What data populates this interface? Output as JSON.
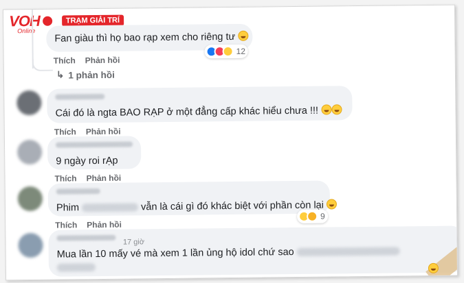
{
  "watermark": {
    "brand": "VOH",
    "sub": "Online",
    "tag": "TRẠM GIẢI TRÍ"
  },
  "comments": [
    {
      "text": "Fan giàu thì họ bao rạp xem cho riêng tư",
      "emoji": "grinning-emoji",
      "like": "Thích",
      "reply": "Phản hồi",
      "reaction_count": "12",
      "replies_link": "1 phản hồi"
    },
    {
      "text": "Cái đó là ngta BAO RẠP ở một đẳng cấp khác hiểu chưa !!!",
      "like": "Thích",
      "reply": "Phản hồi"
    },
    {
      "text": "9 ngày roi rẠp",
      "like": "Thích",
      "reply": "Phản hồi"
    },
    {
      "text_before": "Phim",
      "text_after": "vẫn là cái gì đó khác biệt với phần còn lại",
      "like": "Thích",
      "reply": "Phản hồi",
      "reaction_count": "9"
    },
    {
      "text": "Mua lần 10 mấy vé mà xem 1 lần ủng hộ idol chứ sao",
      "like": "Thích",
      "reply": "Phản hồi",
      "time": "17 giờ"
    }
  ],
  "colors": {
    "bubble": "#f0f2f5",
    "action_text": "#65676b",
    "brand_red": "#e4262b",
    "like_blue": "#1877f2",
    "haha_yellow": "#ffcd3c"
  }
}
